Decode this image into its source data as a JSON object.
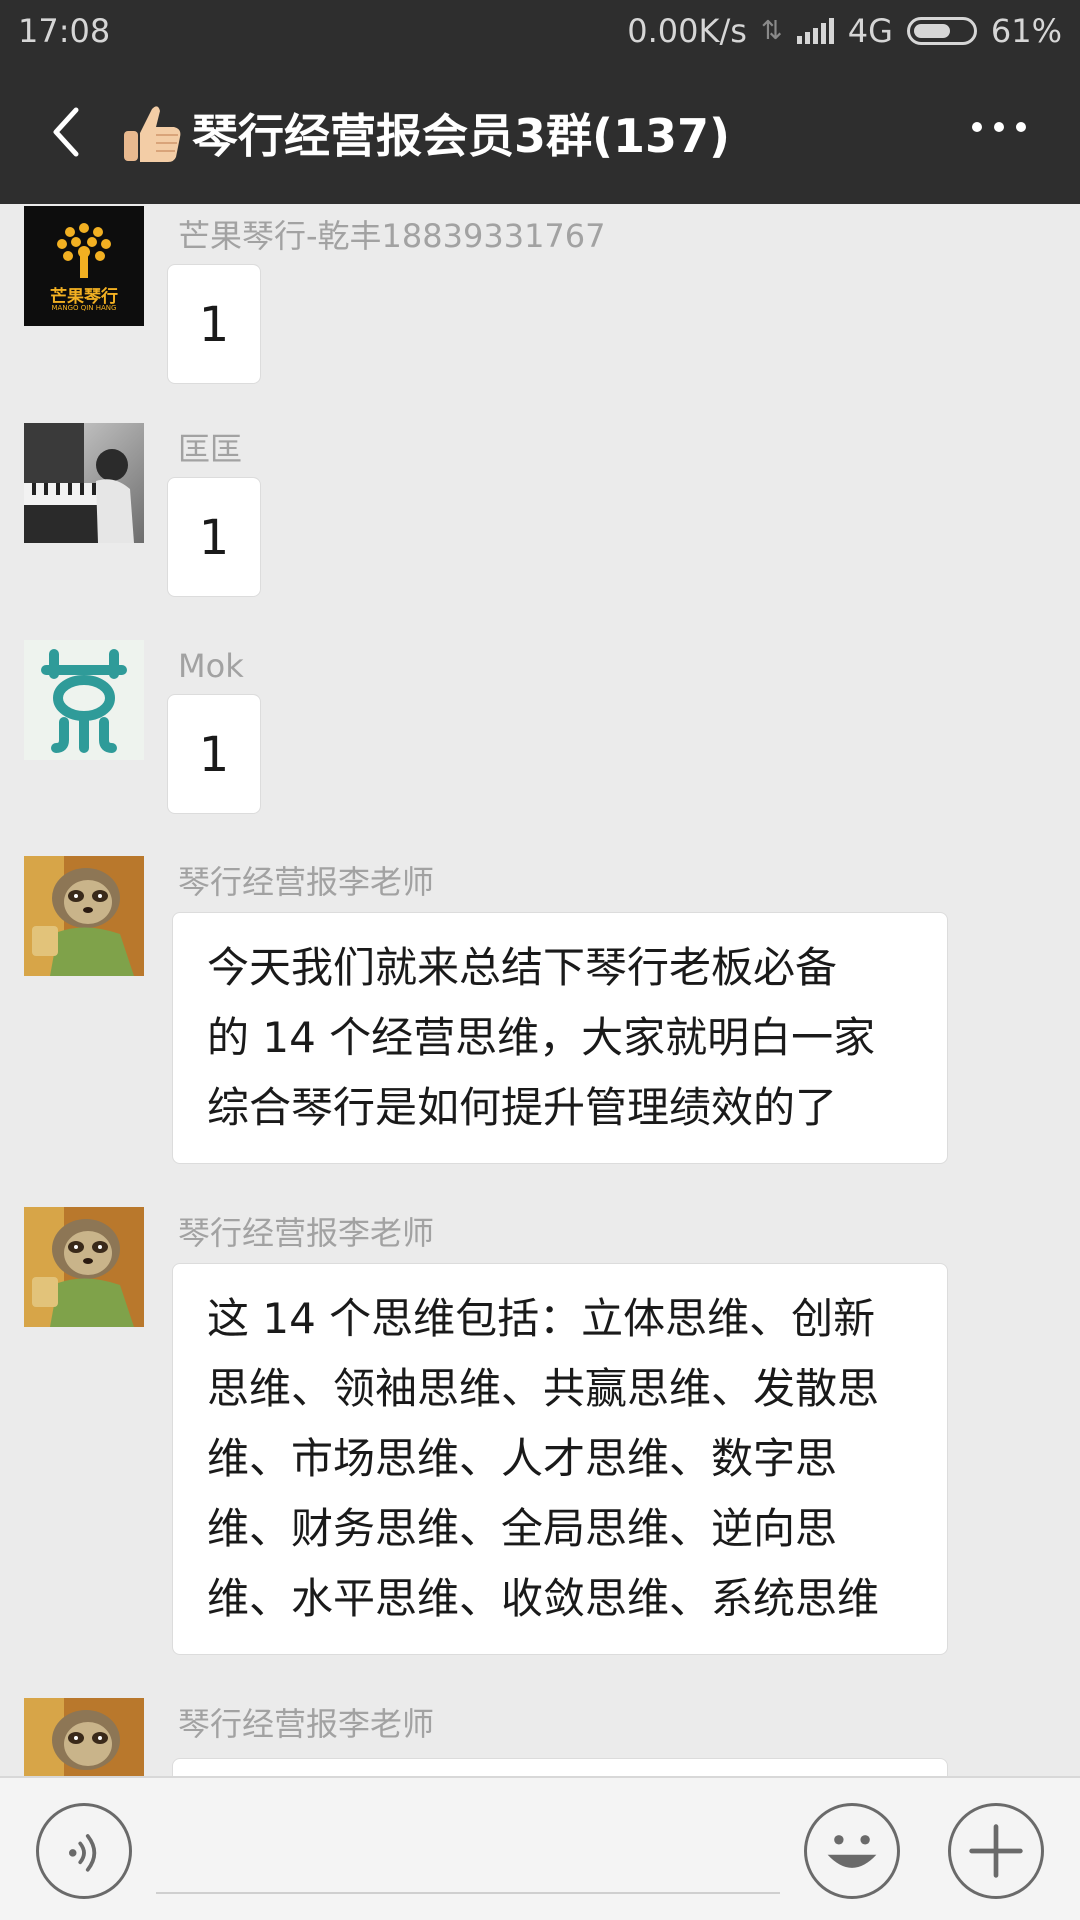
{
  "status_bar": {
    "time": "17:08",
    "net_speed": "0.00K/s",
    "network": "4G",
    "battery": "61%"
  },
  "header": {
    "title": "琴行经营报会员3群(137)",
    "back_icon": "chevron-left-icon",
    "more_icon": "more-dots-icon",
    "title_emoji": "thumbs-up-icon"
  },
  "messages": [
    {
      "sender": "芒果琴行-乾丰18839331767",
      "text": "1",
      "avatar": "mango-logo",
      "avatar_text": "芒果琴行",
      "avatar_sub": "MANGO QIN HANG"
    },
    {
      "sender": "匡匡",
      "text": "1",
      "avatar": "piano-photo"
    },
    {
      "sender": "Mok",
      "text": "1",
      "avatar": "teal-logo"
    },
    {
      "sender": "琴行经营报李老师",
      "lines": [
        "今天我们就来总结下琴行老板必备",
        "的 14 个经营思维，大家就明白一家",
        "综合琴行是如何提升管理绩效的了"
      ],
      "avatar": "sloth"
    },
    {
      "sender": "琴行经营报李老师",
      "lines": [
        "这 14 个思维包括：立体思维、创新",
        "思维、领袖思维、共赢思维、发散思",
        "维、市场思维、人才思维、数字思",
        "维、财务思维、全局思维、逆向思",
        "维、水平思维、收敛思维、系统思维"
      ],
      "avatar": "sloth"
    },
    {
      "sender": "琴行经营报李老师",
      "avatar": "sloth"
    }
  ],
  "colors": {
    "header_bg": "#2e2e2e",
    "chat_bg": "#ebebeb",
    "bubble_bg": "#ffffff",
    "sender_text": "#a2a2a2"
  },
  "input_bar": {
    "voice_icon": "voice-icon",
    "emoji_icon": "emoji-icon",
    "plus_icon": "plus-icon",
    "placeholder": ""
  }
}
